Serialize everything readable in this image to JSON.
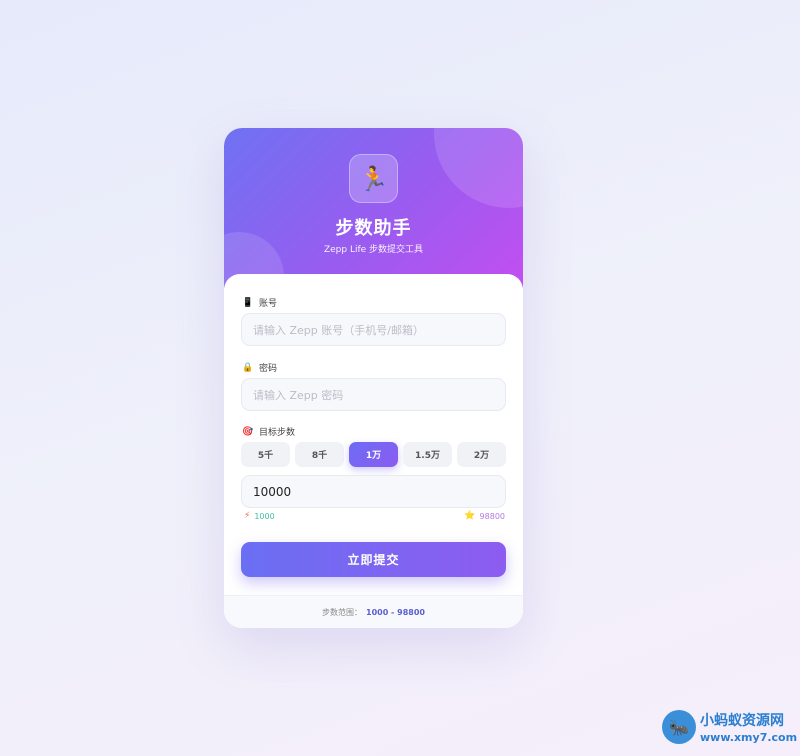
{
  "app": {
    "title": "步数助手",
    "subtitle": "Zepp Life 步数提交工具",
    "logo_icon": "🏃"
  },
  "form": {
    "account": {
      "icon": "📱",
      "label": "账号",
      "placeholder": "请输入 Zepp 账号（手机号/邮箱）"
    },
    "password": {
      "icon": "🔒",
      "label": "密码",
      "placeholder": "请输入 Zepp 密码"
    },
    "steps": {
      "icon": "🎯",
      "label": "目标步数",
      "presets": [
        "5千",
        "8千",
        "1万",
        "1.5万",
        "2万"
      ],
      "selected_preset": "1万",
      "value": "10000",
      "min_icon": "⚡",
      "min": "1000",
      "max_icon": "⭐",
      "max": "98800"
    },
    "submit_label": "立即提交"
  },
  "footer": {
    "label": "步数范围：",
    "range": "1000 - 98800"
  },
  "watermark": {
    "title": "小蚂蚁资源网",
    "url": "www.xmy7.com"
  },
  "colors": {
    "header_gradient_start": "#6f72f2",
    "header_gradient_end": "#c24ef0",
    "accent": "#7b66f2",
    "min_color": "#3fbfa4",
    "max_color": "#b479e0"
  }
}
